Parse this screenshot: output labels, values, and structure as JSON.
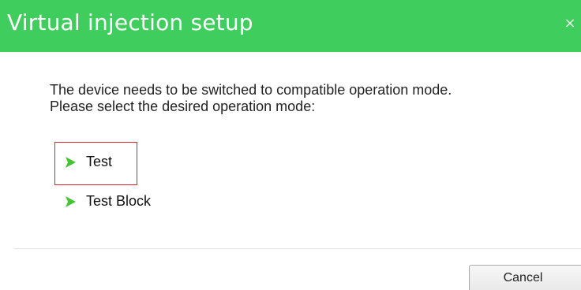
{
  "dialog": {
    "title": "Virtual injection setup",
    "close_glyph": "×",
    "accent_color": "#3fcd5d",
    "message_lines": [
      "The device needs to be switched to compatible operation mode.",
      "Please select the desired operation mode:"
    ],
    "options": [
      {
        "label": "Test",
        "icon": "chevron-right-icon",
        "highlighted": true
      },
      {
        "label": "Test Block",
        "icon": "chevron-right-icon",
        "highlighted": false
      }
    ],
    "highlight_color": "#e0202a",
    "cancel_label": "Cancel"
  }
}
